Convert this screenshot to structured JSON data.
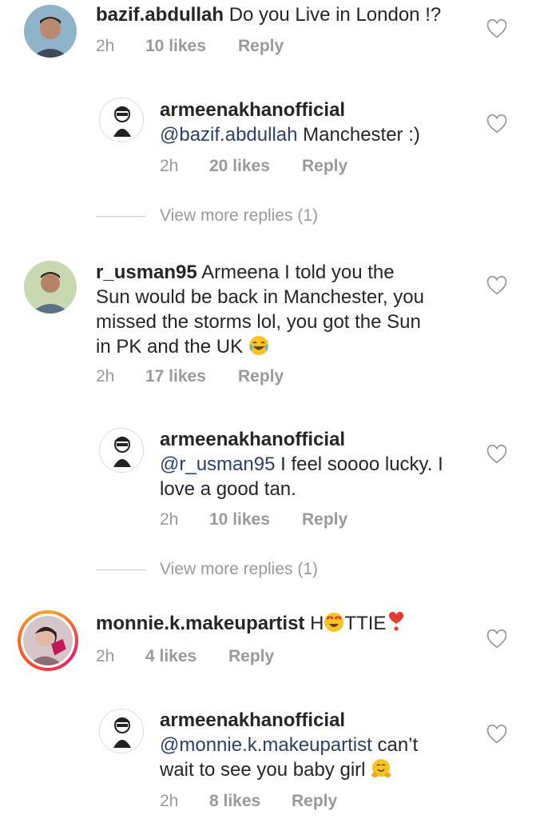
{
  "comments": [
    {
      "username": "bazif.abdullah",
      "text": "Do you Live in London !?",
      "time": "2h",
      "likes": "10 likes",
      "reply": "Reply"
    },
    {
      "username": "armeenakhanofficial",
      "mention": "@bazif.abdullah",
      "text": "Manchester :)",
      "time": "2h",
      "likes": "20 likes",
      "reply": "Reply",
      "view_more": "View more replies (1)"
    },
    {
      "username": "r_usman95",
      "text_l1": "Armeena I told you the",
      "text_l2": "Sun would be back in Manchester, you",
      "text_l3": "missed the storms lol, you got the Sun",
      "text_l4": "in PK and the UK",
      "time": "2h",
      "likes": "17 likes",
      "reply": "Reply"
    },
    {
      "username": "armeenakhanofficial",
      "mention": "@r_usman95",
      "text_l1": "I feel soooo lucky. I",
      "text_l2": "love a good tan.",
      "time": "2h",
      "likes": "10 likes",
      "reply": "Reply",
      "view_more": "View more replies (1)"
    },
    {
      "username": "monnie.k.makeupartist",
      "text_a": "H",
      "text_b": "TTIE",
      "time": "2h",
      "likes": "4 likes",
      "reply": "Reply"
    },
    {
      "username": "armeenakhanofficial",
      "mention": "@monnie.k.makeupartist",
      "text_l1": "can’t",
      "text_l2": "wait to see you baby girl",
      "time": "2h",
      "likes": "8 likes",
      "reply": "Reply"
    }
  ],
  "icons": {
    "heart": "heart-outline-icon",
    "laugh_emoji": "face-with-tears-of-joy",
    "heart_eyes_emoji": "smiling-face-with-heart-eyes",
    "red_heart_emoji": "heavy-heart-exclamation",
    "hug_emoji": "hugging-face"
  }
}
